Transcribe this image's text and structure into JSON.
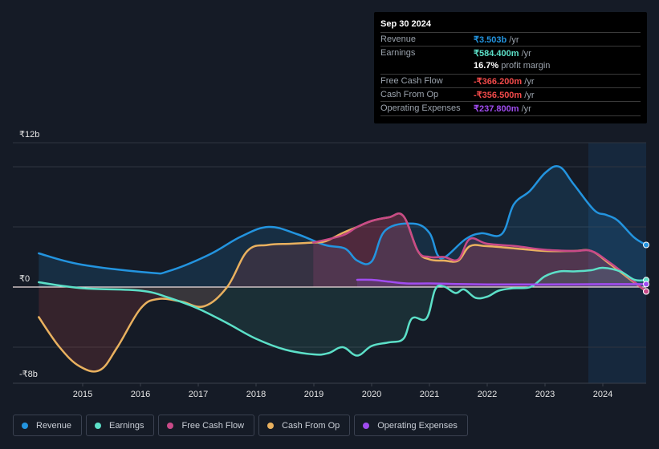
{
  "tooltip": {
    "date": "Sep 30 2024",
    "rows": [
      {
        "label": "Revenue",
        "value": "₹3.503b",
        "unit": " /yr",
        "color": "#2394df"
      },
      {
        "label": "Earnings",
        "value": "₹584.400m",
        "unit": " /yr",
        "color": "#5ce0c8"
      },
      {
        "label": "",
        "value": "16.7%",
        "unit": " profit margin",
        "color": "#ffffff"
      },
      {
        "label": "Free Cash Flow",
        "value": "-₹366.200m",
        "unit": " /yr",
        "color": "#f24a4a"
      },
      {
        "label": "Cash From Op",
        "value": "-₹356.500m",
        "unit": " /yr",
        "color": "#f24a4a"
      },
      {
        "label": "Operating Expenses",
        "value": "₹237.800m",
        "unit": " /yr",
        "color": "#a04cf0"
      }
    ]
  },
  "legend": [
    {
      "label": "Revenue",
      "color": "#2394df"
    },
    {
      "label": "Earnings",
      "color": "#5ce0c8"
    },
    {
      "label": "Free Cash Flow",
      "color": "#c94a88"
    },
    {
      "label": "Cash From Op",
      "color": "#e9b15f"
    },
    {
      "label": "Operating Expenses",
      "color": "#a04cf0"
    }
  ],
  "chart_data": {
    "type": "area",
    "title": "",
    "xlabel": "",
    "ylabel": "",
    "x_ticks": [
      "2015",
      "2016",
      "2017",
      "2018",
      "2019",
      "2020",
      "2021",
      "2022",
      "2023",
      "2024"
    ],
    "y_tick_labels": [
      {
        "value": 12,
        "label": "₹12b"
      },
      {
        "value": 0,
        "label": "₹0"
      },
      {
        "value": -8,
        "label": "-₹8b"
      }
    ],
    "ylim": [
      -8,
      12
    ],
    "xlim": [
      2014.25,
      2024.75
    ],
    "unit": "₹ billions",
    "grid": true,
    "gridlines": [
      10,
      5,
      0,
      -5
    ],
    "highlight_from": 2023.75,
    "legend_position": "bottom",
    "series": [
      {
        "name": "Revenue",
        "color": "#2394df",
        "x": [
          2014.24,
          2014.97,
          2016.15,
          2016.49,
          2017.18,
          2017.74,
          2018.22,
          2018.71,
          2019.19,
          2019.54,
          2019.75,
          2020.0,
          2020.24,
          2020.72,
          2021.0,
          2021.14,
          2021.28,
          2021.63,
          2021.9,
          2022.25,
          2022.46,
          2022.74,
          2023.01,
          2023.25,
          2023.5,
          2023.85,
          2024.06,
          2024.26,
          2024.54,
          2024.75
        ],
        "values": [
          2.8,
          1.87,
          1.2,
          1.33,
          2.67,
          4.2,
          5.0,
          4.4,
          3.5,
          3.2,
          2.2,
          2.13,
          4.73,
          5.27,
          4.5,
          2.67,
          2.53,
          4.0,
          4.47,
          4.4,
          6.87,
          8.0,
          9.53,
          10.0,
          8.53,
          6.4,
          6.0,
          5.53,
          4.13,
          3.5
        ]
      },
      {
        "name": "Earnings",
        "color": "#5ce0c8",
        "x": [
          2014.24,
          2015.0,
          2016.0,
          2016.5,
          2017.0,
          2017.5,
          2018.0,
          2018.5,
          2019.0,
          2019.25,
          2019.5,
          2019.75,
          2020.0,
          2020.3,
          2020.55,
          2020.7,
          2020.95,
          2021.1,
          2021.25,
          2021.45,
          2021.6,
          2021.8,
          2022.0,
          2022.2,
          2022.45,
          2022.75,
          2023.0,
          2023.25,
          2023.5,
          2023.8,
          2024.0,
          2024.3,
          2024.55,
          2024.75
        ],
        "values": [
          0.4,
          -0.1,
          -0.3,
          -0.9,
          -1.8,
          -3.0,
          -4.3,
          -5.2,
          -5.6,
          -5.5,
          -5.0,
          -5.7,
          -4.9,
          -4.6,
          -4.3,
          -2.6,
          -2.6,
          -0.2,
          0.05,
          -0.5,
          -0.2,
          -0.9,
          -0.8,
          -0.3,
          -0.1,
          0.0,
          0.9,
          1.3,
          1.3,
          1.4,
          1.6,
          1.3,
          0.6,
          0.58
        ]
      },
      {
        "name": "Free Cash Flow",
        "color": "#c94a88",
        "x": [
          2018.99,
          2019.5,
          2019.75,
          2020.0,
          2020.3,
          2020.55,
          2020.8,
          2021.0,
          2021.25,
          2021.5,
          2021.7,
          2022.0,
          2022.5,
          2023.0,
          2023.5,
          2023.8,
          2024.1,
          2024.4,
          2024.75
        ],
        "values": [
          3.7,
          4.3,
          5.0,
          5.5,
          5.8,
          5.9,
          3.0,
          2.5,
          2.5,
          2.3,
          4.0,
          3.6,
          3.4,
          3.1,
          3.0,
          3.0,
          2.1,
          1.0,
          -0.37
        ]
      },
      {
        "name": "Cash From Op",
        "color": "#e9b15f",
        "x": [
          2014.24,
          2014.6,
          2014.95,
          2015.3,
          2015.6,
          2016.0,
          2016.3,
          2016.7,
          2017.1,
          2017.5,
          2017.85,
          2018.2,
          2018.6,
          2018.99,
          2019.2,
          2019.5,
          2019.75,
          2020.0,
          2020.3,
          2020.55,
          2020.8,
          2021.0,
          2021.25,
          2021.5,
          2021.7,
          2022.0,
          2022.5,
          2023.0,
          2023.5,
          2023.8,
          2024.1,
          2024.4,
          2024.75
        ],
        "values": [
          -2.5,
          -5.0,
          -6.6,
          -6.9,
          -5.0,
          -1.8,
          -1.0,
          -1.2,
          -1.6,
          0.0,
          3.0,
          3.5,
          3.6,
          3.7,
          3.8,
          4.5,
          5.0,
          5.5,
          5.8,
          5.9,
          3.0,
          2.3,
          2.2,
          2.2,
          3.4,
          3.4,
          3.2,
          3.0,
          3.0,
          3.0,
          2.0,
          0.9,
          -0.36
        ]
      },
      {
        "name": "Operating Expenses",
        "color": "#a04cf0",
        "x": [
          2019.75,
          2020.0,
          2020.3,
          2020.6,
          2021.0,
          2021.5,
          2022.0,
          2022.5,
          2023.0,
          2023.5,
          2024.0,
          2024.5,
          2024.75
        ],
        "values": [
          0.6,
          0.6,
          0.45,
          0.3,
          0.3,
          0.25,
          0.22,
          0.22,
          0.22,
          0.23,
          0.24,
          0.24,
          0.24
        ]
      }
    ]
  }
}
